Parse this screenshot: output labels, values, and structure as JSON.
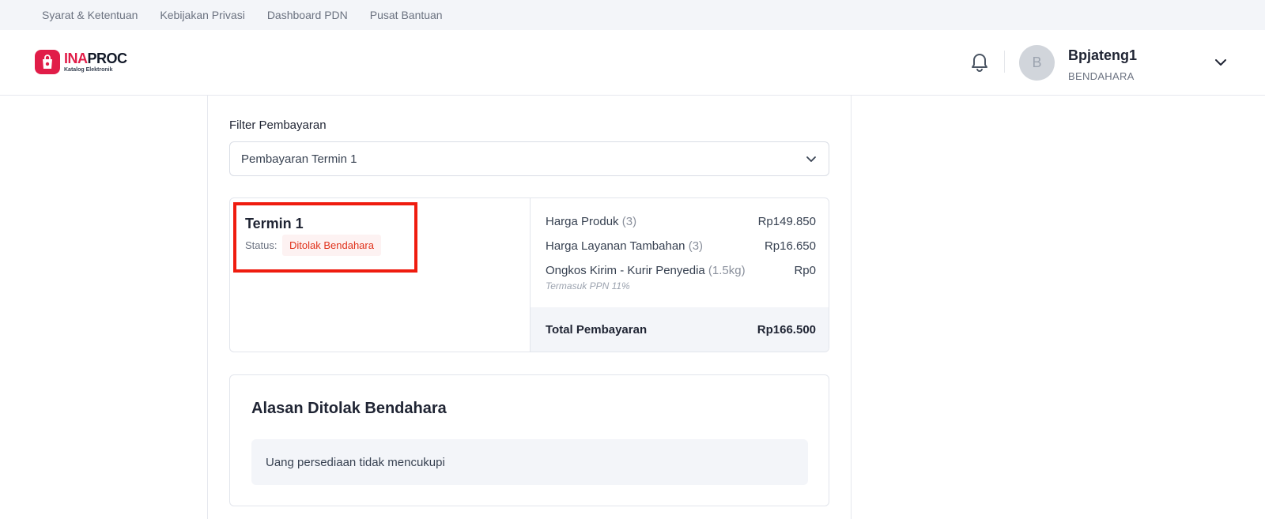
{
  "topbar": {
    "links": [
      "Syarat & Ketentuan",
      "Kebijakan Privasi",
      "Dashboard PDN",
      "Pusat Bantuan"
    ]
  },
  "header": {
    "logo_ina": "INA",
    "logo_proc": "PROC",
    "logo_sub": "Katalog Elektronik",
    "avatar_initial": "B",
    "user_name": "Bpjateng1",
    "user_role": "BENDAHARA"
  },
  "filter": {
    "label": "Filter Pembayaran",
    "selected": "Pembayaran Termin 1"
  },
  "termin": {
    "title": "Termin 1",
    "status_label": "Status:",
    "status_value": "Ditolak Bendahara"
  },
  "summary": {
    "rows": [
      {
        "label": "Harga Produk",
        "qty": "(3)",
        "value": "Rp149.850"
      },
      {
        "label": "Harga Layanan Tambahan",
        "qty": "(3)",
        "value": "Rp16.650"
      },
      {
        "label": "Ongkos Kirim - Kurir Penyedia",
        "qty": "(1.5kg)",
        "value": "Rp0"
      }
    ],
    "tax_note": "Termasuk PPN 11%",
    "total_label": "Total Pembayaran",
    "total_value": "Rp166.500"
  },
  "reason": {
    "title": "Alasan Ditolak Bendahara",
    "text": "Uang persediaan tidak mencukupi"
  },
  "colors": {
    "brand": "#e11d48",
    "highlight": "#ef1c0f",
    "status_text": "#e0321b",
    "status_bg": "#fdf2f2"
  }
}
